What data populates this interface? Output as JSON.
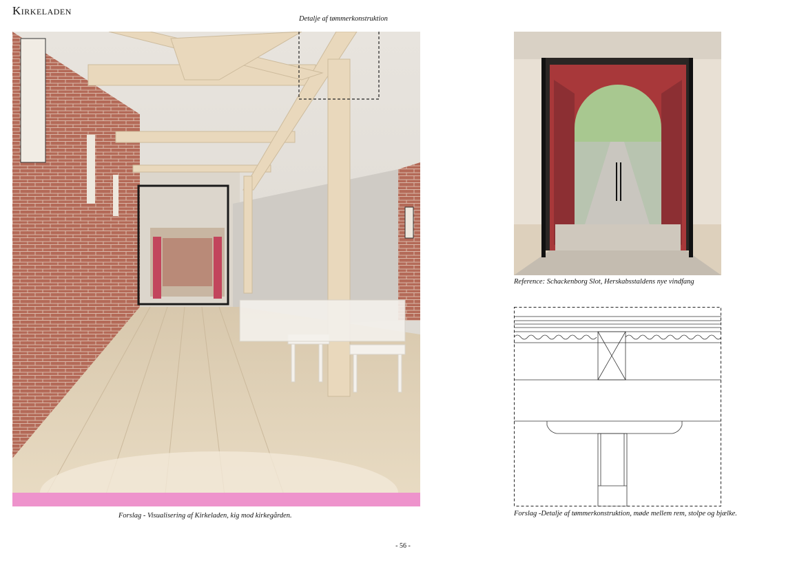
{
  "section_title": "Kirkeladen",
  "detail_label": "Detalje af tømmerkonstruktion",
  "captions": {
    "render": "Forslag - Visualisering af Kirkeladen, kig mod kirkegården.",
    "photo": "Reference: Schackenborg Slot, Herskabsstaldens nye vindfang",
    "drawing": "Forslag -Detalje af tømmerkonstruktion, møde mellem rem, stolpe og bjælke."
  },
  "page_number": "- 56 -"
}
